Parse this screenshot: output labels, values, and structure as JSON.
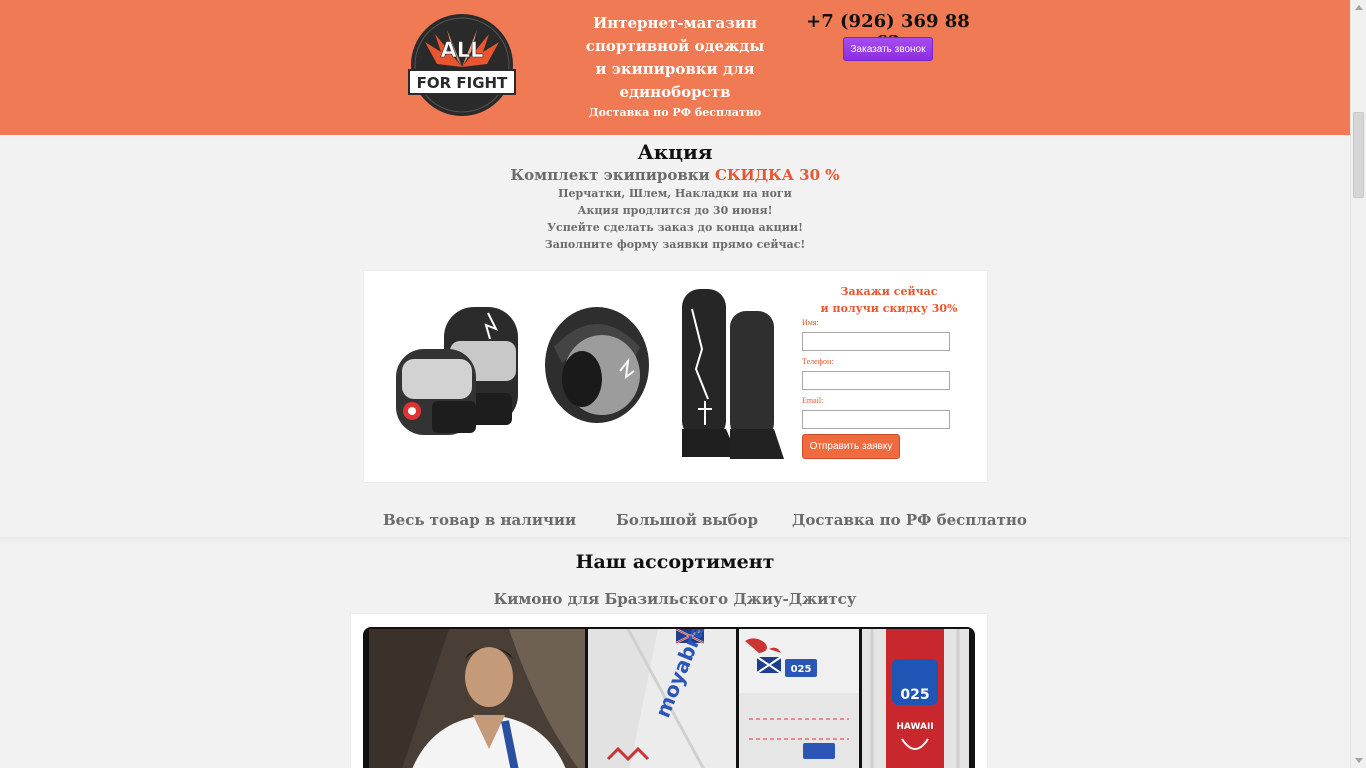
{
  "header": {
    "logo_top": "ALL",
    "logo_bottom": "FOR FIGHT",
    "tagline": "Интернет-магазин спортивной одежды и экипировки для единоборств",
    "delivery_note": "Доставка по РФ бесплатно",
    "phone": "+7 (926) 369 88 62",
    "callback_label": "Заказать звонок"
  },
  "promo": {
    "title": "Акция",
    "subtitle_prefix": "Комплект экипировки",
    "subtitle_highlight": "СКИДКА 30 %",
    "lines": [
      "Перчатки, Шлем, Накладки на ноги",
      "Акция продлится до 30 июня!",
      "Успейте сделать заказ до конца акции!",
      "Заполните форму заявки прямо сейчас!"
    ]
  },
  "order_form": {
    "title_line1": "Закажи сейчас",
    "title_line2": "и получи скидку 30%",
    "name_label": "Имя:",
    "phone_label": "Телефон:",
    "email_label": "Email:",
    "submit_label": "Отправить заявку"
  },
  "features": [
    "Весь товар в наличии",
    "Большой выбор",
    "Доставка по РФ бесплатно"
  ],
  "assortment": {
    "title": "Наш ассортимент",
    "category": "Кимоно для Бразильского Джиу-Джитсу"
  },
  "gallery_prints": {
    "brand": "moyabrand",
    "number": "025",
    "patch": "HAWAII"
  },
  "colors": {
    "header_bg": "#f07a53",
    "accent": "#e8552f",
    "callback_btn": "#9a3ee8",
    "muted_text": "#6b6b6b"
  }
}
